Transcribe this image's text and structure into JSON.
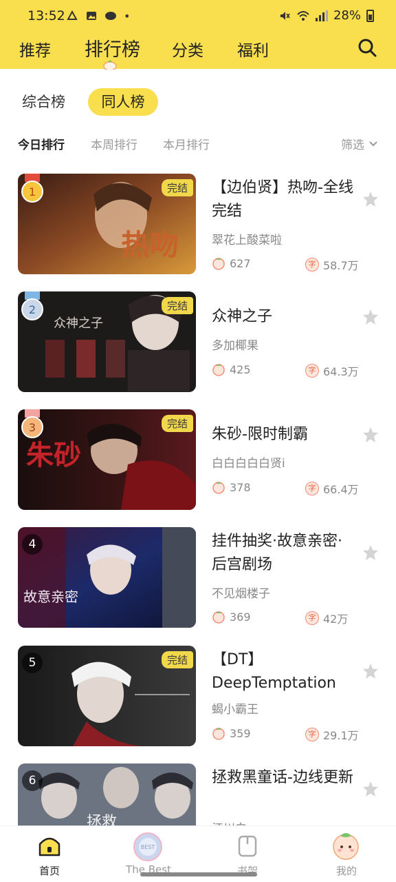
{
  "status": {
    "time": "13:52",
    "battery": "28%",
    "dot": "•"
  },
  "nav": {
    "tabs": [
      {
        "label": "推荐"
      },
      {
        "label": "排行榜"
      },
      {
        "label": "分类"
      },
      {
        "label": "福利"
      }
    ]
  },
  "segments": {
    "left": "综合榜",
    "right": "同人榜"
  },
  "subtabs": {
    "today": "今日排行",
    "week": "本周排行",
    "month": "本月排行",
    "filter": "筛选"
  },
  "badge_done": "完结",
  "items": [
    {
      "rank": "1",
      "title": "【边伯贤】热吻-全线完结",
      "author": "翠花上酸菜啦",
      "reads": "627",
      "words": "58.7万",
      "finished": true,
      "cover_text": "热吻"
    },
    {
      "rank": "2",
      "title": "众神之子",
      "author": "多加椰果",
      "reads": "425",
      "words": "64.3万",
      "finished": true,
      "cover_text": "众神之子"
    },
    {
      "rank": "3",
      "title": "朱砂-限时制霸",
      "author": "白白白白白贤i",
      "reads": "378",
      "words": "66.4万",
      "finished": true,
      "cover_text": "朱砂"
    },
    {
      "rank": "4",
      "title": "挂件抽奖·故意亲密·后宫剧场",
      "author": "不见烟楼子",
      "reads": "369",
      "words": "42万",
      "finished": false,
      "cover_text": "故意亲密"
    },
    {
      "rank": "5",
      "title": "【DT】DeepTemptation",
      "author": "蝎小霸王",
      "reads": "359",
      "words": "29.1万",
      "finished": true,
      "cover_text": ""
    },
    {
      "rank": "6",
      "title": "拯救黑童话-边线更新",
      "author": "江川白",
      "reads": "",
      "words": "",
      "finished": false,
      "cover_text": "拯救"
    }
  ],
  "bottom_nav": [
    {
      "label": "首页"
    },
    {
      "label": "The Best"
    },
    {
      "label": "书架"
    },
    {
      "label": "我的"
    }
  ],
  "colors": {
    "accent": "#f9de4e",
    "muted": "#999999"
  }
}
